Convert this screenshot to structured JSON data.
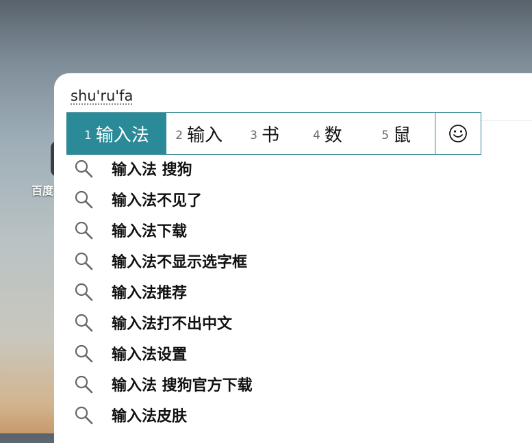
{
  "desktop": {
    "icon_label": "百度"
  },
  "ime": {
    "composition": "shu'ru'fa",
    "candidates": [
      {
        "num": "1",
        "text": "输入法"
      },
      {
        "num": "2",
        "text": "输入"
      },
      {
        "num": "3",
        "text": "书"
      },
      {
        "num": "4",
        "text": "数"
      },
      {
        "num": "5",
        "text": "鼠"
      }
    ],
    "emoji_icon": "smiley-icon",
    "accent_color": "#2b8a98"
  },
  "suggestions": [
    "输入法 搜狗",
    "输入法不见了",
    "输入法下载",
    "输入法不显示选字框",
    "输入法推荐",
    "输入法打不出中文",
    "输入法设置",
    "输入法 搜狗官方下载",
    "输入法皮肤"
  ]
}
